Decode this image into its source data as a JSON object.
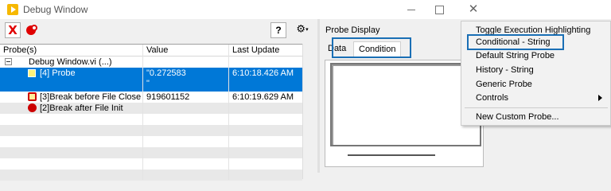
{
  "window": {
    "title": "Debug Window"
  },
  "toolbar": {
    "clear_icon": "X",
    "help_label": "?",
    "gear_caret": "▾"
  },
  "grid": {
    "headers": [
      "Probe(s)",
      "Value",
      "Last Update"
    ],
    "rows": [
      {
        "probe": "Debug Window.vi (...)",
        "value": "",
        "update": ""
      },
      {
        "probe": "[4] Probe",
        "value": "\"0.272583",
        "value2": "\"",
        "update": "6:10:18.426 AM"
      },
      {
        "probe": "[3]Break before File Close",
        "value": "919601152",
        "update": "6:10:19.629 AM"
      },
      {
        "probe": "[2]Break after File Init",
        "value": "",
        "update": ""
      }
    ]
  },
  "probe_display": {
    "title": "Probe Display",
    "tabs": [
      "Data",
      "Condition"
    ]
  },
  "context_menu": {
    "items": [
      "Toggle Execution Highlighting",
      "Conditional - String",
      "Default String Probe",
      "History - String",
      "Generic Probe",
      "Controls",
      "New Custom Probe..."
    ]
  },
  "colors": {
    "selection": "#0078d7",
    "highlight_box": "#1a6fb5",
    "error_red": "#e00000",
    "app_icon": "#f6b800"
  }
}
